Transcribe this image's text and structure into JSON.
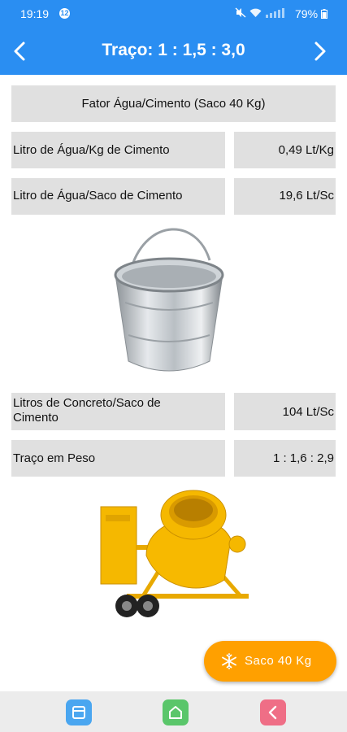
{
  "status": {
    "time": "19:19",
    "notification_count": "12",
    "battery": "79%"
  },
  "appbar": {
    "title": "Traço: 1 : 1,5 : 3,0"
  },
  "table": {
    "header": "Fator Água/Cimento (Saco 40 Kg)",
    "rows_top": [
      {
        "label": "Litro de Água/Kg de Cimento",
        "value": "0,49 Lt/Kg"
      },
      {
        "label": "Litro de Água/Saco de Cimento",
        "value": "19,6 Lt/Sc"
      }
    ],
    "rows_bottom": [
      {
        "label": "Litros de Concreto/Saco de Cimento",
        "value": "104 Lt/Sc"
      },
      {
        "label": "Traço em Peso",
        "value": "1 : 1,6 : 2,9"
      }
    ]
  },
  "fab": {
    "label": "Saco 40 Kg",
    "icon": "snowflake-icon"
  },
  "bottom_nav": {
    "icons": [
      "window-icon",
      "home-icon",
      "back-icon"
    ]
  },
  "colors": {
    "primary": "#2a8ef2",
    "fab": "#ffa000",
    "cell": "#e0e0e0",
    "mixer": "#f5b800"
  }
}
